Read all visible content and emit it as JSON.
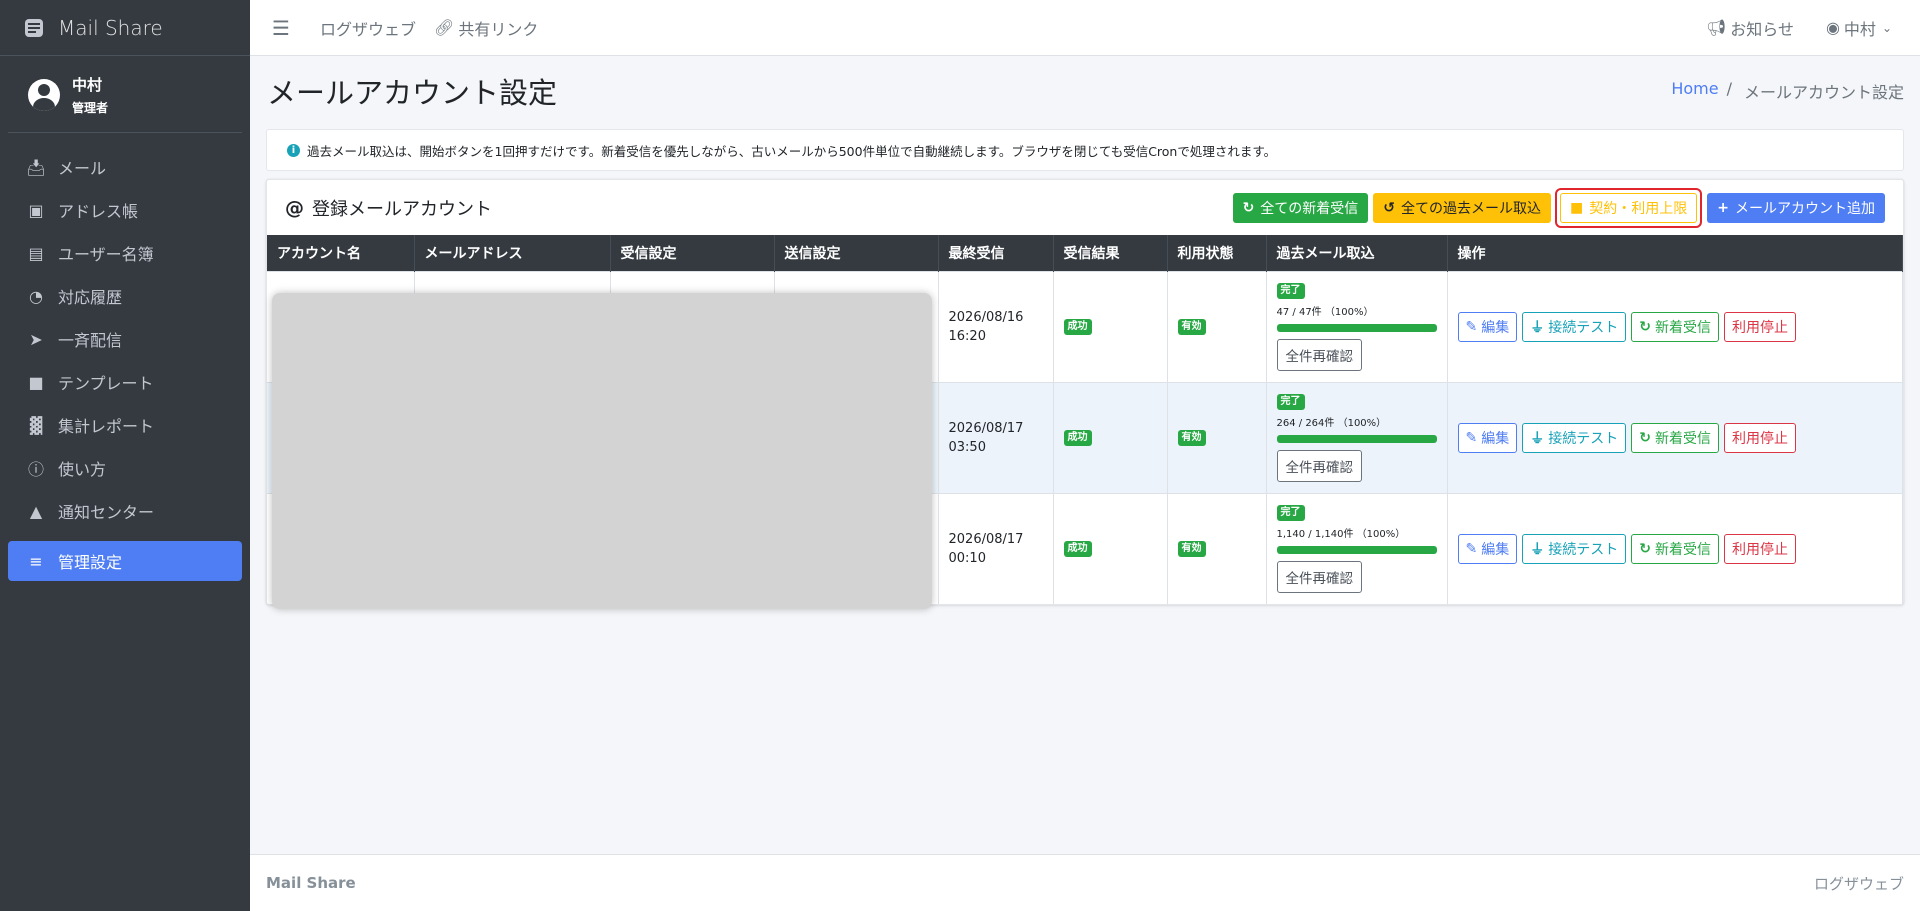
{
  "brand": {
    "name": "Mail Share"
  },
  "user": {
    "name": "中村",
    "role": "管理者"
  },
  "sidebar": {
    "items": [
      {
        "label": "メール",
        "icon": "inbox-icon"
      },
      {
        "label": "アドレス帳",
        "icon": "address-book-icon"
      },
      {
        "label": "ユーザー名簿",
        "icon": "id-badge-icon"
      },
      {
        "label": "対応履歴",
        "icon": "headset-icon"
      },
      {
        "label": "一斉配信",
        "icon": "paper-plane-icon"
      },
      {
        "label": "テンプレート",
        "icon": "file-icon"
      },
      {
        "label": "集計レポート",
        "icon": "chart-icon"
      },
      {
        "label": "使い方",
        "icon": "question-icon"
      },
      {
        "label": "通知センター",
        "icon": "bell-icon"
      },
      {
        "label": "管理設定",
        "icon": "sliders-icon",
        "active": true
      }
    ]
  },
  "topbar": {
    "links": [
      "ログザウェブ",
      "共有リンク"
    ],
    "notifications_label": "お知らせ",
    "user_label": "中村"
  },
  "page": {
    "title": "メールアカウント設定",
    "breadcrumb": {
      "home": "Home",
      "current": "メールアカウント設定"
    }
  },
  "info": {
    "text": "過去メール取込は、開始ボタンを1回押すだけです。新着受信を優先しながら、古いメールから500件単位で自動継続します。ブラウザを閉じても受信Cronで処理されます。"
  },
  "card": {
    "title": "登録メールアカウント",
    "buttons": {
      "fetch_all_new": "全ての新着受信",
      "import_all_past": "全ての過去メール取込",
      "contract_limits": "契約・利用上限",
      "add_account": "メールアカウント追加"
    }
  },
  "table": {
    "headers": [
      "アカウント名",
      "メールアドレス",
      "受信設定",
      "送信設定",
      "最終受信",
      "受信結果",
      "利用状態",
      "過去メール取込",
      "操作"
    ],
    "rows": [
      {
        "last_received_date": "2026/08/16",
        "last_received_time": "16:20",
        "result": "成功",
        "status": "有効",
        "import_status": "完了",
        "import_count": "47 / 47件 （100%）",
        "progress": 1.0,
        "recheck": "全件再確認"
      },
      {
        "last_received_date": "2026/08/17",
        "last_received_time": "03:50",
        "result": "成功",
        "status": "有効",
        "import_status": "完了",
        "import_count": "264 / 264件 （100%）",
        "progress": 1.0,
        "recheck": "全件再確認"
      },
      {
        "last_received_date": "2026/08/17",
        "last_received_time": "00:10",
        "result": "成功",
        "status": "有効",
        "import_status": "完了",
        "import_count": "1,140 / 1,140件 （100%）",
        "progress": 1.0,
        "recheck": "全件再確認"
      }
    ],
    "actions": {
      "edit": "編集",
      "test": "接続テスト",
      "fetch": "新着受信",
      "disable": "利用停止"
    }
  },
  "footer": {
    "brand": "Mail Share",
    "right": "ログザウェブ"
  },
  "colors": {
    "primary": "#4e7df4",
    "success": "#28a745",
    "warning": "#ffc107",
    "danger": "#dc3545",
    "sidebar": "#343a40"
  }
}
